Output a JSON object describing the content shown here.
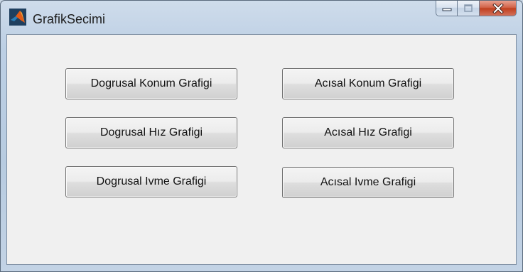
{
  "window": {
    "title": "GrafikSecimi",
    "icon": "matlab-logo-icon",
    "caption_buttons": [
      "minimize-icon",
      "maximize-icon",
      "close-icon"
    ]
  },
  "buttons": {
    "dogrusal_konum": "Dogrusal Konum Grafigi",
    "dogrusal_hiz": "Dogrusal Hız Grafigi",
    "dogrusal_ivme": "Dogrusal Ivme Grafigi",
    "acisal_konum": "Acısal Konum Grafigi",
    "acisal_hiz": "Acısal Hız Grafigi",
    "acisal_ivme": "Acısal Ivme Grafigi"
  },
  "colors": {
    "close_button": "#c9482a",
    "client_background": "#f0f0f0",
    "titlebar": "#bccfe4"
  }
}
